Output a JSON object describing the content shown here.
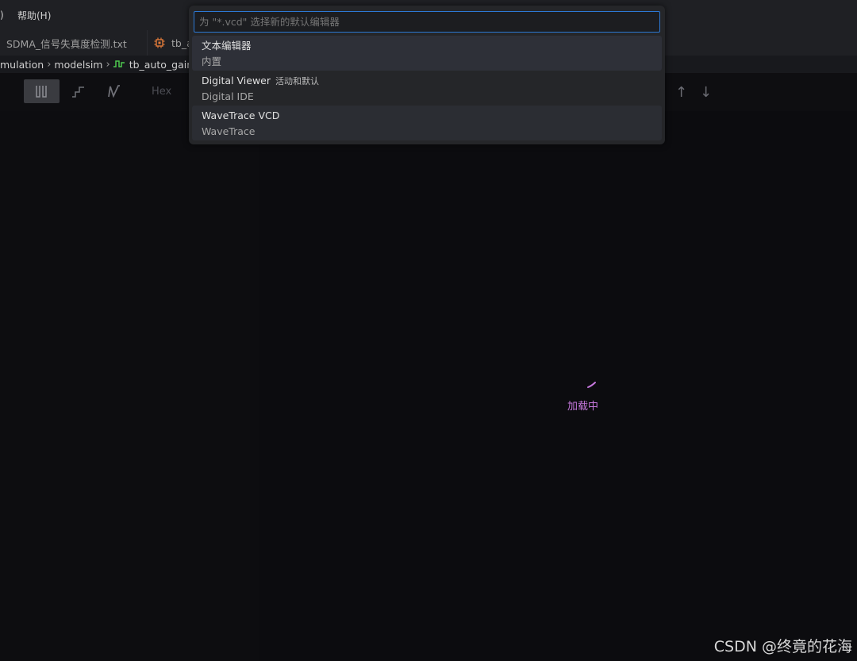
{
  "menubar": {
    "leading_fragment": ")",
    "help_label": "帮助(H)"
  },
  "tabs": [
    {
      "label": "SDMA_信号失真度检测.txt"
    },
    {
      "label": "tb_a"
    }
  ],
  "breadcrumbs": {
    "items": [
      "mulation",
      "modelsim",
      "tb_auto_gain_"
    ]
  },
  "toolbar": {
    "hex_label": "Hex",
    "up_arrow": "↑",
    "down_arrow": "↓"
  },
  "quick_pick": {
    "placeholder": "为 \"*.vcd\" 选择新的默认编辑器",
    "items": [
      {
        "label": "文本编辑器",
        "description": "",
        "detail": "内置"
      },
      {
        "label": "Digital Viewer",
        "description": "活动和默认",
        "detail": "Digital IDE"
      },
      {
        "label": "WaveTrace VCD",
        "description": "",
        "detail": "WaveTrace"
      }
    ]
  },
  "loading": {
    "text": "加载中",
    "color": "#c678dd"
  },
  "watermark": "CSDN @终竟的花海",
  "colors": {
    "accent_border": "#2c78d4",
    "tab_icon": "#e07a3a",
    "wave_icon": "#4ec94e"
  }
}
